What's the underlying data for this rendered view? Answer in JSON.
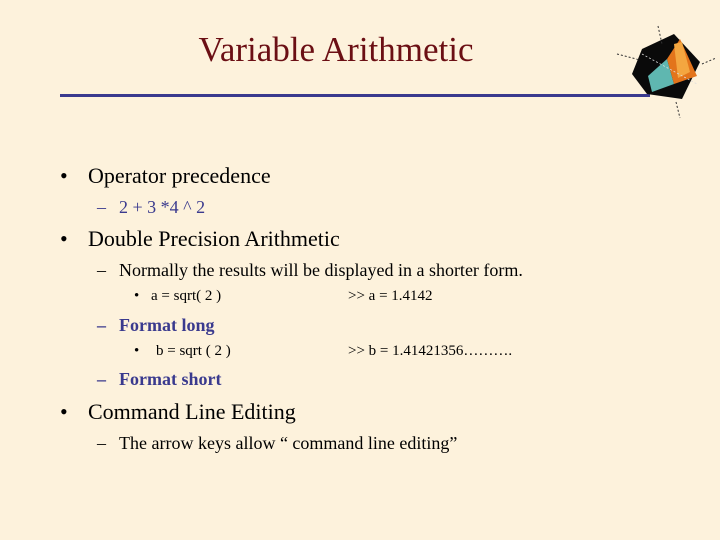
{
  "slide": {
    "title": "Variable Arithmetic",
    "logo": "matlab-logo-icon",
    "colors": {
      "background": "#FDF2DC",
      "title": "#6B0F14",
      "accent": "#3A3A8E"
    }
  },
  "bullets": {
    "b1": {
      "marker": "•",
      "text": "Operator precedence"
    },
    "b1_sub1": {
      "marker": "–",
      "text": "2 + 3 *4 ^ 2"
    },
    "b2": {
      "marker": "•",
      "text": "Double Precision Arithmetic"
    },
    "b2_sub1": {
      "marker": "–",
      "text": "Normally the results will be displayed in a shorter form."
    },
    "b2_sub1_item1": {
      "marker": "•",
      "code": "a = sqrt( 2 )",
      "result": ">>   a = 1.4142"
    },
    "b2_sub2": {
      "marker": "–",
      "text": "Format long"
    },
    "b2_sub2_item1": {
      "marker": "•",
      "code": "b = sqrt ( 2 )",
      "result": ">> b = 1.41421356………."
    },
    "b2_sub3": {
      "marker": "–",
      "text": "Format short"
    },
    "b3": {
      "marker": "•",
      "text": "Command Line Editing"
    },
    "b3_sub1": {
      "marker": "–",
      "text": "The arrow keys allow “ command line editing”"
    }
  }
}
